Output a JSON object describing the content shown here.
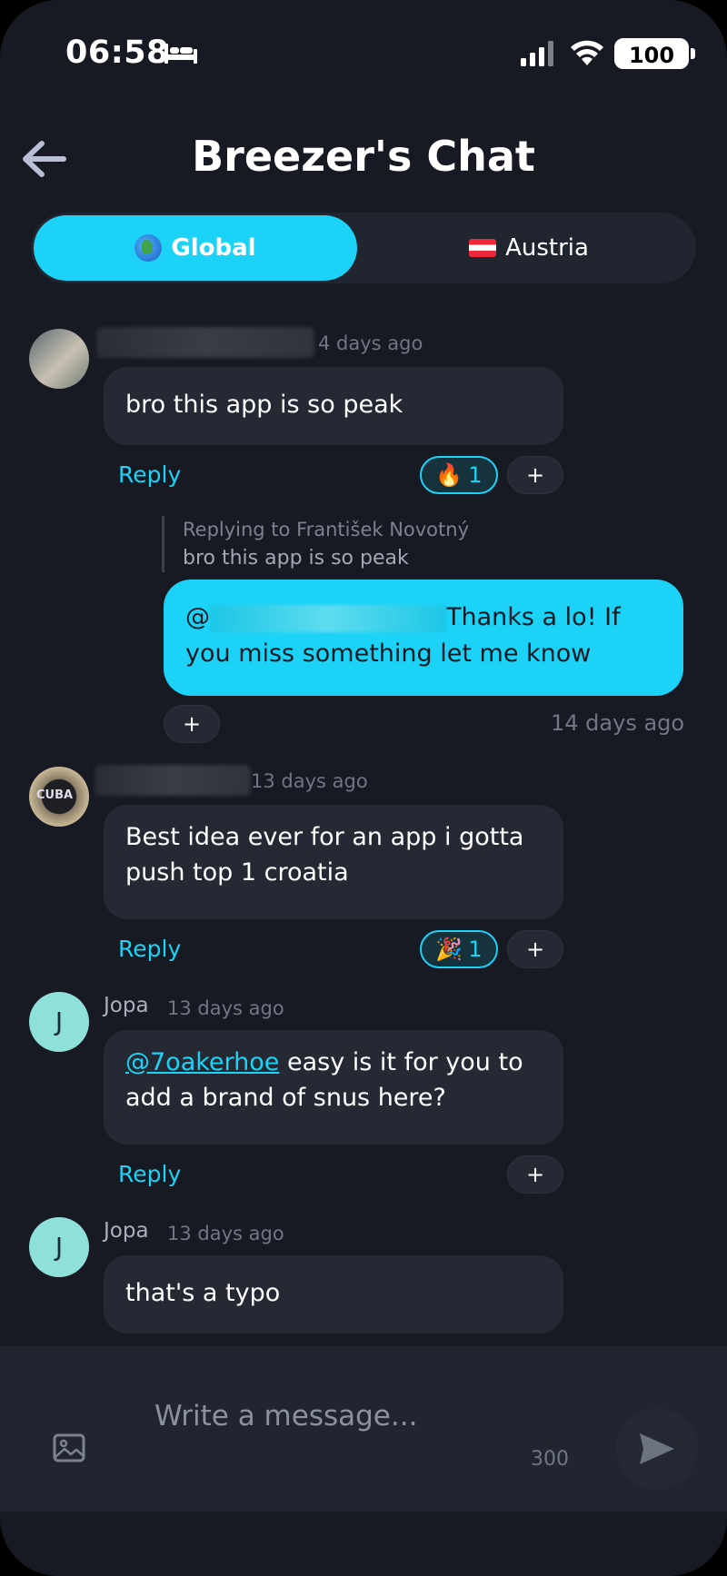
{
  "status": {
    "time": "06:58",
    "battery": "100"
  },
  "header": {
    "title": "Breezer's Chat"
  },
  "tabs": [
    {
      "label": "Global",
      "icon": "globe-icon"
    },
    {
      "label": "Austria",
      "icon": "austria-flag-icon"
    }
  ],
  "messages": [
    {
      "time": "4 days ago",
      "text": "bro this app is so peak",
      "reply_label": "Reply",
      "reaction": {
        "emoji": "🔥",
        "count": "1"
      },
      "add_label": "+"
    },
    {
      "replying_to": "Replying to František Novotný",
      "quoted": "bro this app is so peak",
      "mention_prefix": "@",
      "text": "Thanks a lo! If you miss something let me know",
      "add_label": "+",
      "time": "14 days ago"
    },
    {
      "time": "13 days ago",
      "text": "Best idea ever for an app i gotta push top 1 croatia",
      "reply_label": "Reply",
      "reaction": {
        "emoji": "🎉",
        "count": "1"
      },
      "add_label": "+"
    },
    {
      "avatar": "J",
      "name": "Jopa",
      "time": "13 days ago",
      "mention": "@7oakerhoe",
      "text": " easy is it for you to add a brand of snus here?",
      "reply_label": "Reply",
      "add_label": "+"
    },
    {
      "avatar": "J",
      "name": "Jopa",
      "time": "13 days ago",
      "text": "that's a typo"
    }
  ],
  "composer": {
    "placeholder": "Write a message...",
    "counter": "300"
  },
  "colors": {
    "accent": "#1cd3f7",
    "background": "#171923",
    "bubble": "#252934"
  }
}
